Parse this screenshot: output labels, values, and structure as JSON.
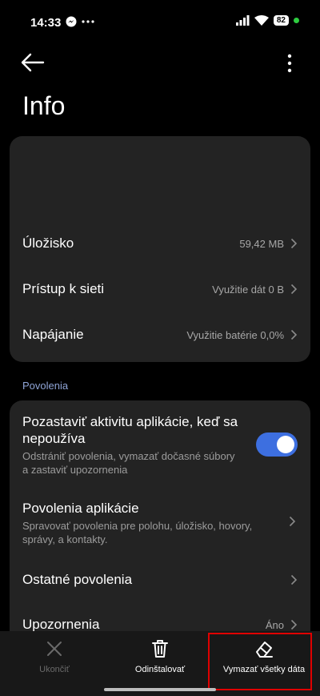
{
  "status_bar": {
    "time": "14:33",
    "battery": "82",
    "left_icons": [
      "messenger-icon",
      "more-dots-icon"
    ],
    "right_icons": [
      "signal-icon",
      "wifi-icon",
      "battery-icon",
      "green-dot"
    ]
  },
  "header": {
    "title": "Info"
  },
  "storage_card": {
    "rows": [
      {
        "label": "Úložisko",
        "value": "59,42 MB"
      },
      {
        "label": "Prístup k sieti",
        "value": "Využitie dát 0 B"
      },
      {
        "label": "Napájanie",
        "value": "Využitie batérie 0,0%"
      }
    ]
  },
  "permissions": {
    "section_title": "Povolenia",
    "pause_activity": {
      "title": "Pozastaviť aktivitu aplikácie, keď sa nepoužíva",
      "subtitle": "Odstrániť povolenia, vymazať dočasné súbory a zastaviť upozornenia",
      "enabled": true
    },
    "app_permissions": {
      "title": "Povolenia aplikácie",
      "subtitle": "Spravovať povolenia pre polohu, úložisko, hovory, správy, a kontakty."
    },
    "other_permissions": {
      "title": "Ostatné povolenia"
    },
    "notifications": {
      "title": "Upozornenia",
      "value": "Áno"
    }
  },
  "bottom_actions": {
    "stop": "Ukončiť",
    "uninstall": "Odinštalovať",
    "clear_data": "Vymazať všetky dáta"
  },
  "colors": {
    "accent": "#3d6fe0",
    "card": "#232323",
    "section_header": "#8fa4d6",
    "highlight": "#e00000"
  }
}
